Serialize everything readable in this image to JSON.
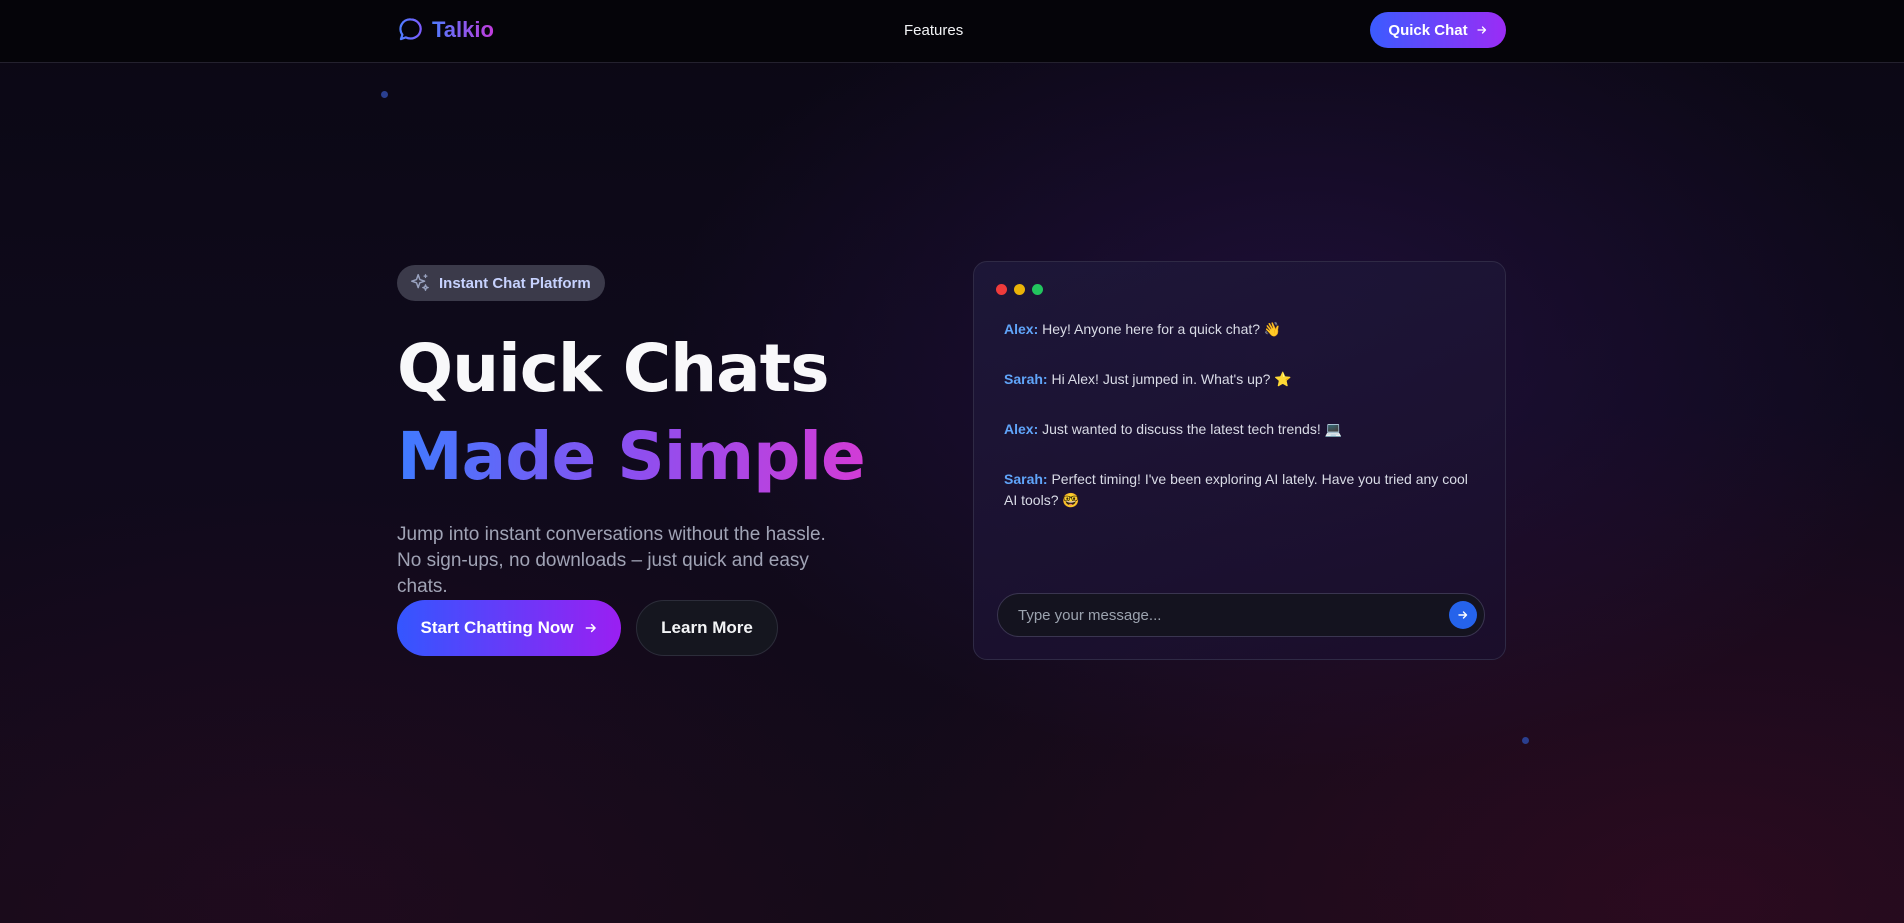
{
  "brand": {
    "name": "Talkio",
    "icon": "chat-bubble-icon"
  },
  "nav": {
    "links": [
      {
        "label": "Features"
      }
    ],
    "cta_label": "Quick Chat",
    "cta_icon": "arrow-right-icon"
  },
  "hero": {
    "badge": {
      "icon": "sparkle-icon",
      "label": "Instant Chat Platform"
    },
    "title_line1": "Quick Chats",
    "title_line2": "Made Simple",
    "subtitle": "Jump into instant conversations without the hassle. No sign-ups, no downloads – just quick and easy chats.",
    "primary_button": "Start Chatting Now",
    "secondary_button": "Learn More"
  },
  "chat_preview": {
    "messages": [
      {
        "author": "Alex:",
        "text": "Hey! Anyone here for a quick chat? 👋"
      },
      {
        "author": "Sarah:",
        "text": "Hi Alex! Just jumped in. What's up? ⭐"
      },
      {
        "author": "Alex:",
        "text": "Just wanted to discuss the latest tech trends! 💻"
      },
      {
        "author": "Sarah:",
        "text": "Perfect timing! I've been exploring AI lately. Have you tried any cool AI tools? 🤓"
      }
    ],
    "input_placeholder": "Type your message...",
    "send_icon": "arrow-right-icon"
  },
  "colors": {
    "accent_blue": "#3b5bff",
    "accent_purple": "#9b2cf5",
    "author_name": "#60a5fa"
  }
}
